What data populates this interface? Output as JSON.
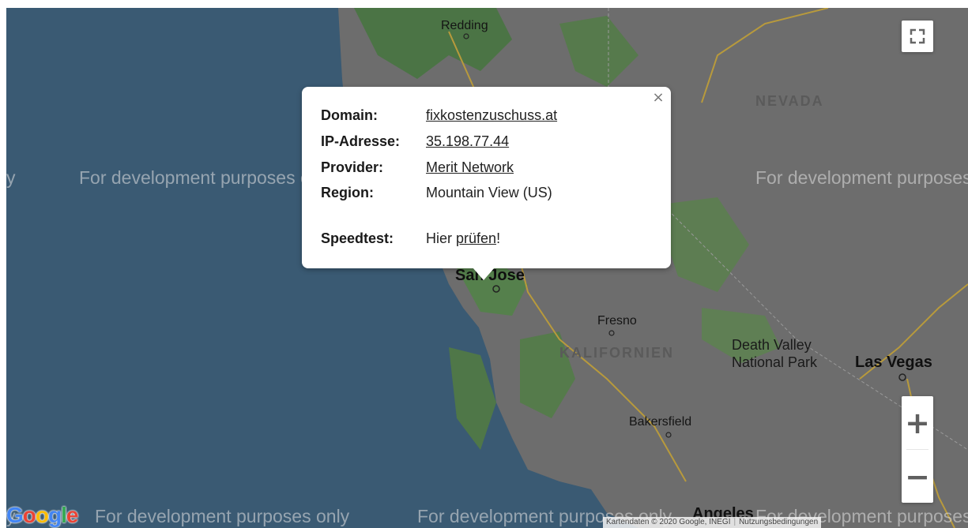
{
  "map": {
    "watermark_text": "For development purposes only",
    "edge_fragment": "y",
    "state_labels": [
      "NEVADA",
      "KALIFORNIEN"
    ],
    "city_labels": [
      "Redding",
      "San Jose",
      "Fresno",
      "Bakersfield",
      "Las Vegas"
    ],
    "park_label_line1": "Death Valley",
    "park_label_line2": "National Park",
    "partial_bottom_label": "Angeles",
    "colors": {
      "ocean": "#3a5a73",
      "land": "#6e6e6e",
      "vegetation": "#4f7a45",
      "highway": "#b89a3c",
      "infowindow_bg": "#ffffff"
    }
  },
  "controls": {
    "fullscreen_icon": "fullscreen-icon",
    "zoom_in": "+",
    "zoom_out": "−"
  },
  "infowindow": {
    "close_symbol": "×",
    "rows": [
      {
        "key": "Domain:",
        "value": "fixkostenzuschuss.at"
      },
      {
        "key": "IP-Adresse:",
        "value": "35.198.77.44"
      },
      {
        "key": "Provider:",
        "value": "Merit Network"
      },
      {
        "key": "Region:",
        "value": "Mountain View (US)"
      }
    ],
    "speedtest": {
      "key": "Speedtest:",
      "prefix": "Hier ",
      "link": "prüfen",
      "suffix": "!"
    }
  },
  "footer": {
    "logo": "Google",
    "attribution": "Kartendaten © 2020 Google, INEGI",
    "terms": "Nutzungsbedingungen"
  }
}
